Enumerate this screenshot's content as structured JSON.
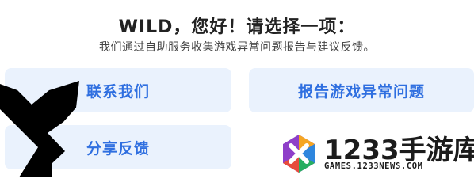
{
  "header": {
    "title": "WILD，您好！请选择一项：",
    "subtitle": "我们通过自助服务收集游戏异常问题报告与建议反馈。"
  },
  "options": {
    "contact_us": "联系我们",
    "report_issue": "报告游戏异常问题",
    "share_feedback": "分享反馈"
  },
  "watermark": {
    "brand": "1233手游库",
    "url": "GAMES.1233NEWS.COM"
  },
  "colors": {
    "accent": "#2f6fe0",
    "button_bg": "#eaf2fd",
    "title": "#222222",
    "subtitle": "#444444"
  }
}
